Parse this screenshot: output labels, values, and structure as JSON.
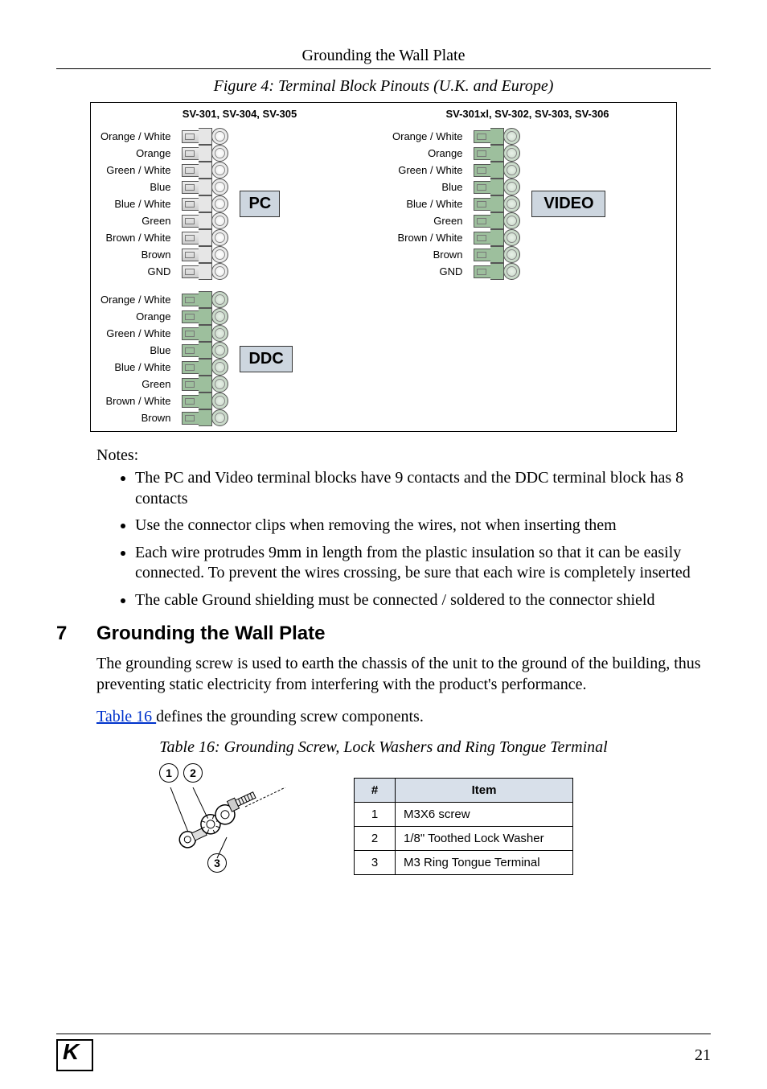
{
  "running_header": "Grounding the Wall Plate",
  "figure4_caption": "Figure 4: Terminal Block Pinouts (U.K. and Europe)",
  "diagram": {
    "left_title": "SV-301, SV-304, SV-305",
    "right_title": "SV-301xl, SV-302, SV-303, SV-306",
    "wires9": [
      "Orange / White",
      "Orange",
      "Green / White",
      "Blue",
      "Blue / White",
      "Green",
      "Brown / White",
      "Brown",
      "GND"
    ],
    "wires8": [
      "Orange / White",
      "Orange",
      "Green / White",
      "Blue",
      "Blue / White",
      "Green",
      "Brown / White",
      "Brown"
    ],
    "pc_label": "PC",
    "ddc_label": "DDC",
    "video_label": "VIDEO"
  },
  "notes_heading": "Notes:",
  "notes": [
    "The PC and Video terminal blocks have 9 contacts and the DDC terminal block has 8 contacts",
    "Use the connector clips when removing the wires, not when inserting them",
    "Each wire protrudes 9mm in length from the plastic insulation so that it can be easily connected. To prevent the wires crossing, be sure that each wire is completely inserted",
    "The cable Ground shielding must be connected / soldered to the connector shield"
  ],
  "section": {
    "num": "7",
    "title": "Grounding the Wall Plate"
  },
  "para1": "The grounding screw is used to earth the chassis of the unit to the ground of the building, thus preventing static electricity from interfering with the product's performance.",
  "para2_link": "Table 16 ",
  "para2_rest": "defines the grounding screw components.",
  "table16_caption": "Table 16: Grounding Screw, Lock Washers and Ring Tongue Terminal",
  "table16": {
    "header_num": "#",
    "header_item": "Item",
    "rows": [
      {
        "n": "1",
        "item": "M3X6 screw"
      },
      {
        "n": "2",
        "item": "1/8\" Toothed Lock Washer"
      },
      {
        "n": "3",
        "item": "M3 Ring Tongue Terminal"
      }
    ]
  },
  "callouts": {
    "c1": "1",
    "c2": "2",
    "c3": "3"
  },
  "page_number": "21"
}
